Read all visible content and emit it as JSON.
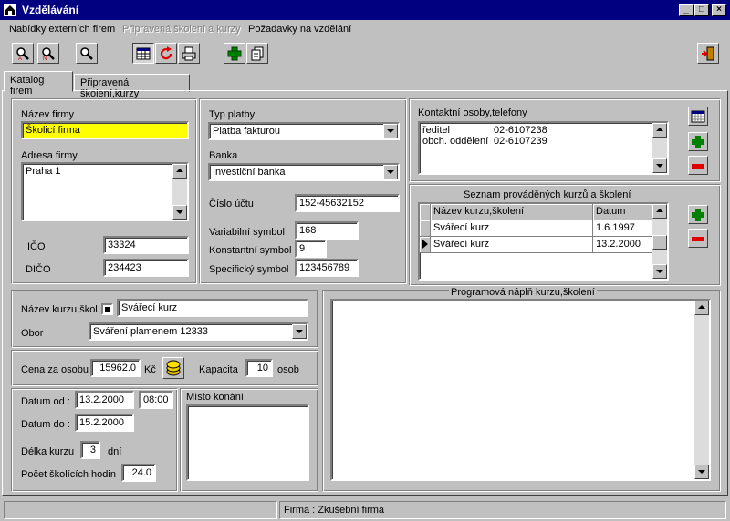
{
  "window": {
    "title": "Vzdělávání"
  },
  "menu": {
    "items": [
      {
        "label": "Nabídky externích firem"
      },
      {
        "label": "Připravená školení a kurzy"
      },
      {
        "label": "Požadavky na vzdělání"
      }
    ]
  },
  "tabs": [
    {
      "label": "Katalog firem"
    },
    {
      "label": "Připravená školení,kurzy"
    }
  ],
  "firm": {
    "name_label": "Název firmy",
    "name_value": "Školicí firma",
    "address_label": "Adresa firmy",
    "address_value": "Praha 1",
    "ico_label": "IČO",
    "ico_value": "33324",
    "dico_label": "DIČO",
    "dico_value": "234423"
  },
  "payment": {
    "type_label": "Typ platby",
    "type_value": "Platba fakturou",
    "bank_label": "Banka",
    "bank_value": "Investiční banka",
    "account_label": "Číslo účtu",
    "account_value": "152-45632152",
    "varsym_label": "Variabilní symbol",
    "varsym_value": "168",
    "constsym_label": "Konstantní symbol",
    "constsym_value": "9",
    "specsym_label": "Specifický symbol",
    "specsym_value": "123456789"
  },
  "contacts": {
    "label": "Kontaktní osoby,telefony",
    "rows": [
      {
        "name": "ředitel",
        "phone": "02-6107238"
      },
      {
        "name": "obch. oddělení",
        "phone": "02-6107239"
      }
    ]
  },
  "courses": {
    "label": "Seznam prováděných kurzů a školení",
    "headers": [
      "Název kurzu,školení",
      "Datum"
    ],
    "rows": [
      {
        "name": "Svářecí kurz",
        "date": "1.6.1997"
      },
      {
        "name": "Svářecí kurz",
        "date": "13.2.2000"
      }
    ]
  },
  "course_detail": {
    "name_label": "Název kurzu,škol.",
    "name_value": "Svářecí kurz",
    "field_label": "Obor",
    "field_value": "Sváření plamenem  12333",
    "price_label": "Cena za osobu",
    "price_value": "15962.0",
    "currency": "Kč",
    "capacity_label": "Kapacita",
    "capacity_value": "10",
    "capacity_unit": "osob",
    "date_from_label": "Datum od :",
    "date_from_value": "13.2.2000",
    "time_from_value": "08:00",
    "date_to_label": "Datum do :",
    "date_to_value": "15.2.2000",
    "length_label": "Délka kurzu",
    "length_value": "3",
    "length_unit": "dní",
    "hours_label": "Počet školících hodin",
    "hours_value": "24.0",
    "place_label": "Místo konání",
    "program_label": "Programová náplň kurzu,školení"
  },
  "status": {
    "text": "Firma :  Zkušební firma"
  }
}
